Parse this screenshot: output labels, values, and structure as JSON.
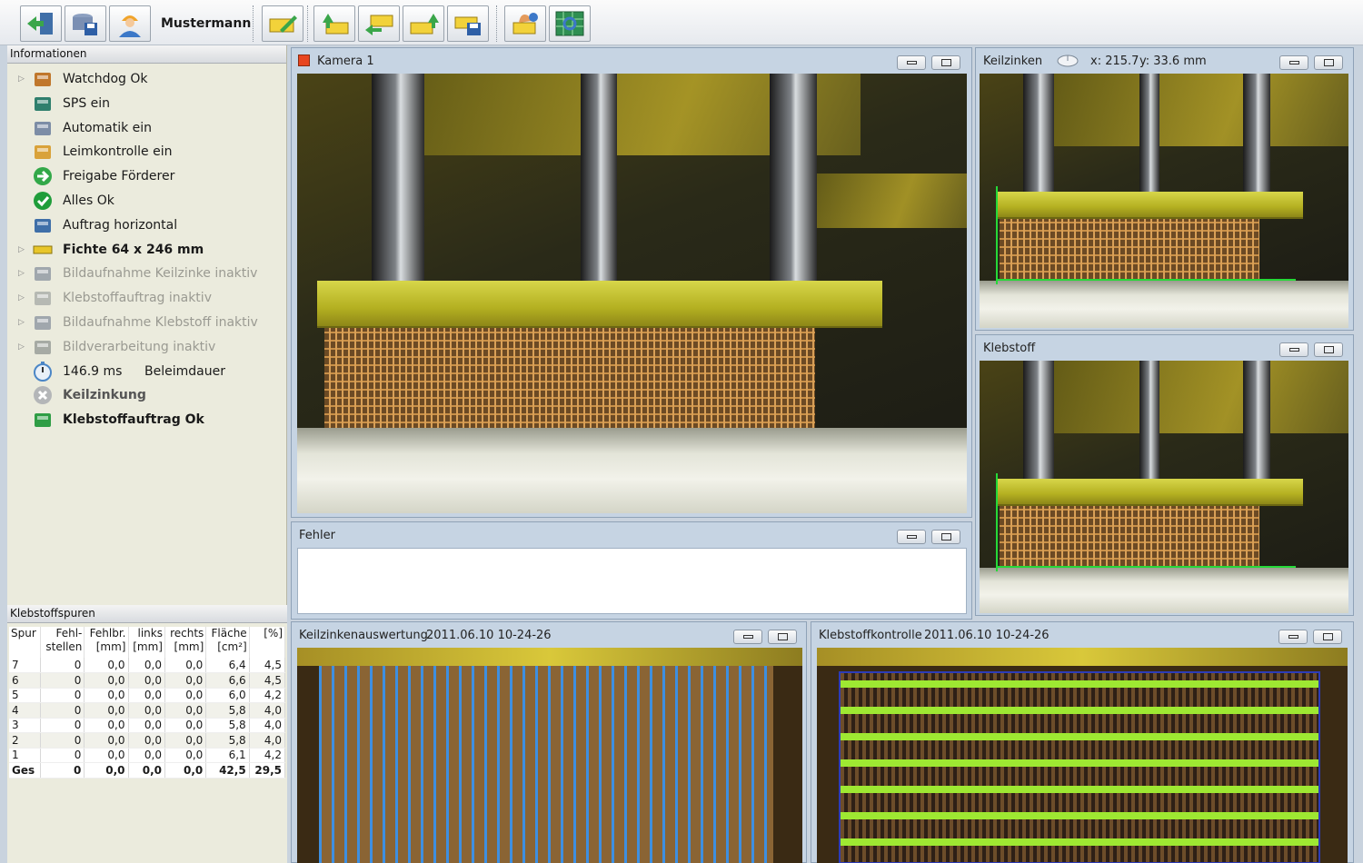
{
  "toolbar": {
    "user_name": "Mustermann",
    "buttons": [
      "login-icon",
      "database-save-icon",
      "user-icon",
      "edit-icon",
      "import-icon",
      "transfer-icon",
      "export-icon",
      "save-data-icon",
      "settings-hand-icon",
      "calibration-icon"
    ]
  },
  "info_panel": {
    "header": "Informationen",
    "items": [
      {
        "label": "Watchdog Ok",
        "icon": "watchdog-icon",
        "expander": true,
        "style": "normal"
      },
      {
        "label": "SPS ein",
        "icon": "plc-icon",
        "expander": false,
        "style": "normal"
      },
      {
        "label": "Automatik ein",
        "icon": "gears-icon",
        "expander": false,
        "style": "normal"
      },
      {
        "label": "Leimkontrolle ein",
        "icon": "glue-control-icon",
        "expander": false,
        "style": "normal"
      },
      {
        "label": "Freigabe Förderer",
        "icon": "green-arrow-icon",
        "expander": false,
        "style": "normal"
      },
      {
        "label": "Alles Ok",
        "icon": "green-check-icon",
        "expander": false,
        "style": "normal"
      },
      {
        "label": "Auftrag horizontal",
        "icon": "horizontal-job-icon",
        "expander": false,
        "style": "normal"
      },
      {
        "label": "Fichte 64 x 246 mm",
        "icon": "wood-board-icon",
        "expander": true,
        "style": "bold"
      },
      {
        "label": "Bildaufnahme Keilzinke inaktiv",
        "icon": "camera-icon",
        "expander": true,
        "style": "inactive"
      },
      {
        "label": "Klebstoffauftrag inaktiv",
        "icon": "glue-apply-icon",
        "expander": true,
        "style": "inactive"
      },
      {
        "label": "Bildaufnahme Klebstoff inaktiv",
        "icon": "camera-icon",
        "expander": true,
        "style": "inactive"
      },
      {
        "label": "Bildverarbeitung inaktiv",
        "icon": "image-processing-icon",
        "expander": true,
        "style": "inactive"
      },
      {
        "label": "146.9 ms",
        "sub": "Beleimdauer",
        "icon": "stopwatch-icon",
        "expander": false,
        "style": "normal"
      },
      {
        "label": "Keilzinkung",
        "icon": "gray-x-icon",
        "expander": false,
        "style": "bold-muted"
      },
      {
        "label": "Klebstoffauftrag Ok",
        "icon": "glue-ok-icon",
        "expander": false,
        "style": "bold"
      }
    ]
  },
  "spuren": {
    "header": "Klebstoffspuren",
    "columns": [
      [
        "Spur",
        ""
      ],
      [
        "Fehl-",
        "stellen"
      ],
      [
        "Fehlbr.",
        "[mm]"
      ],
      [
        "links",
        "[mm]"
      ],
      [
        "rechts",
        "[mm]"
      ],
      [
        "Fläche",
        "[cm²]"
      ],
      [
        "",
        "[%]"
      ]
    ],
    "rows": [
      [
        "7",
        "0",
        "0,0",
        "0,0",
        "0,0",
        "6,4",
        "4,5"
      ],
      [
        "6",
        "0",
        "0,0",
        "0,0",
        "0,0",
        "6,6",
        "4,5"
      ],
      [
        "5",
        "0",
        "0,0",
        "0,0",
        "0,0",
        "6,0",
        "4,2"
      ],
      [
        "4",
        "0",
        "0,0",
        "0,0",
        "0,0",
        "5,8",
        "4,0"
      ],
      [
        "3",
        "0",
        "0,0",
        "0,0",
        "0,0",
        "5,8",
        "4,0"
      ],
      [
        "2",
        "0",
        "0,0",
        "0,0",
        "0,0",
        "5,8",
        "4,0"
      ],
      [
        "1",
        "0",
        "0,0",
        "0,0",
        "0,0",
        "6,1",
        "4,2"
      ]
    ],
    "total": [
      "Ges",
      "0",
      "0,0",
      "0,0",
      "0,0",
      "42,5",
      "29,5"
    ]
  },
  "windows": {
    "kamera": {
      "title": "Kamera 1"
    },
    "fehler": {
      "title": "Fehler"
    },
    "keilzinken": {
      "title": "Keilzinken",
      "coord_x": "x: 215.7",
      "coord_y": "y: 33.6 mm"
    },
    "klebstoff": {
      "title": "Klebstoff"
    },
    "keilzinkenauswertung": {
      "title": "Keilzinkenauswertung",
      "timestamp": "2011.06.10 10-24-26"
    },
    "klebstoffkontrolle": {
      "title": "Klebstoffkontrolle",
      "timestamp": "2011.06.10 10-24-26"
    }
  },
  "colors": {
    "overlay_green": "#25d938",
    "overlay_blue": "#3e8fe0",
    "beam_yellow": "#c9c431",
    "panel_bg": "#ebebdd"
  }
}
